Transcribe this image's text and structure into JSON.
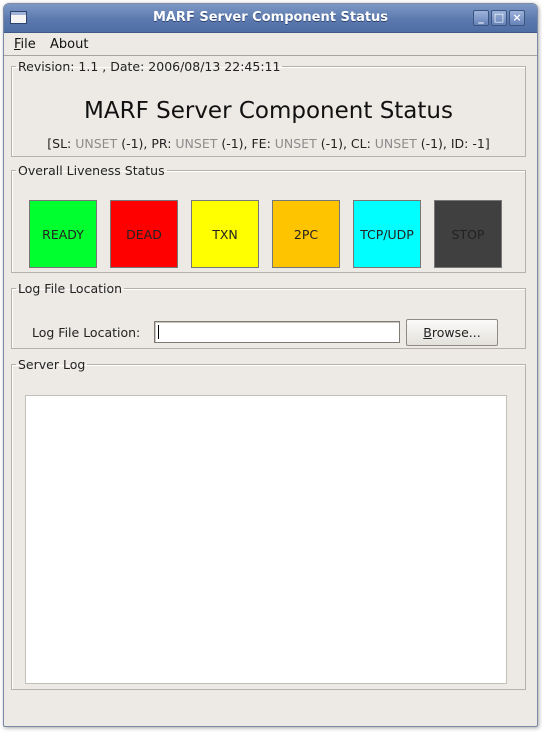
{
  "window": {
    "title": "MARF Server Component Status"
  },
  "menu": {
    "file": {
      "mnemonic": "F",
      "rest": "ile"
    },
    "about": "About"
  },
  "header": {
    "legend": "Revision: 1.1 , Date: 2006/08/13 22:45:11",
    "title": "MARF Server Component Status",
    "status": {
      "open": "[SL: ",
      "sl_value": "UNSET",
      "sl_code": " (-1), PR: ",
      "pr_value": "UNSET",
      "pr_code": " (-1), FE: ",
      "fe_value": "UNSET",
      "fe_code": " (-1), CL: ",
      "cl_value": "UNSET",
      "cl_code": " (-1), ID: -1]"
    }
  },
  "liveness": {
    "legend": "Overall Liveness Status",
    "boxes": [
      {
        "label": "READY",
        "color": "#00ff2e"
      },
      {
        "label": "DEAD",
        "color": "#ff0000"
      },
      {
        "label": "TXN",
        "color": "#ffff00"
      },
      {
        "label": "2PC",
        "color": "#ffc400"
      },
      {
        "label": "TCP/UDP",
        "color": "#00ffff"
      },
      {
        "label": "STOP",
        "color": "#404040"
      }
    ]
  },
  "log_location": {
    "legend": "Log File Location",
    "label": "Log File Location:",
    "value": "",
    "browse": {
      "mnemonic": "B",
      "rest": "rowse..."
    }
  },
  "server_log": {
    "legend": "Server Log",
    "content": ""
  }
}
